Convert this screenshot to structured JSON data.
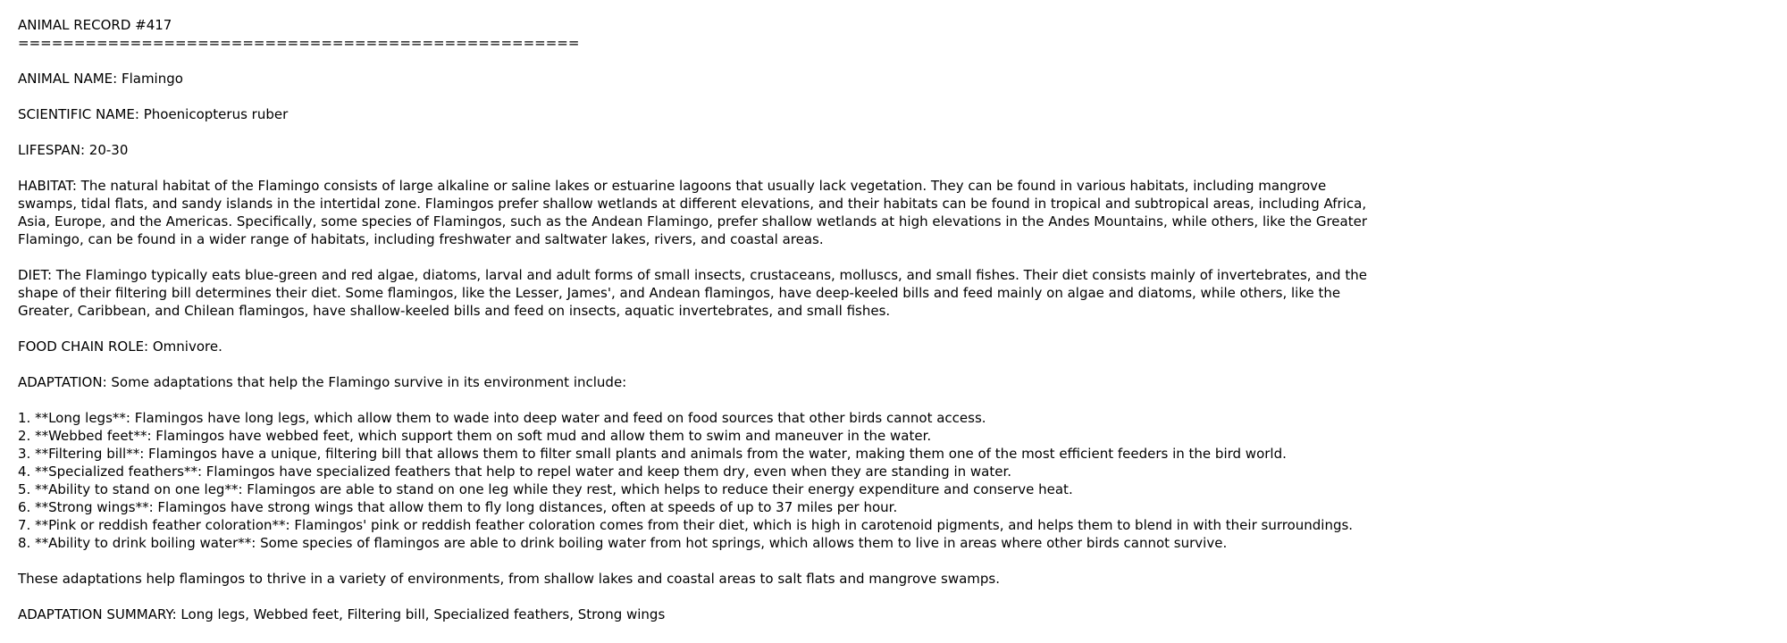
{
  "record": {
    "title": "ANIMAL RECORD #417",
    "divider": "=================================================="
  },
  "fields": {
    "animal_name": "ANIMAL NAME: Flamingo",
    "scientific_name": "SCIENTIFIC NAME: Phoenicopterus ruber",
    "lifespan": "LIFESPAN: 20-30",
    "habitat": "HABITAT: The natural habitat of the Flamingo consists of large alkaline or saline lakes or estuarine lagoons that usually lack vegetation. They can be found in various habitats, including mangrove swamps, tidal flats, and sandy islands in the intertidal zone. Flamingos prefer shallow wetlands at different elevations, and their habitats can be found in tropical and subtropical areas, including Africa, Asia, Europe, and the Americas. Specifically, some species of Flamingos, such as the Andean Flamingo, prefer shallow wetlands at high elevations in the Andes Mountains, while others, like the Greater Flamingo, can be found in a wider range of habitats, including freshwater and saltwater lakes, rivers, and coastal areas.",
    "diet": "DIET: The Flamingo typically eats blue-green and red algae, diatoms, larval and adult forms of small insects, crustaceans, molluscs, and small fishes. Their diet consists mainly of invertebrates, and the shape of their filtering bill determines their diet. Some flamingos, like the Lesser, James', and Andean flamingos, have deep-keeled bills and feed mainly on algae and diatoms, while others, like the Greater, Caribbean, and Chilean flamingos, have shallow-keeled bills and feed on insects, aquatic invertebrates, and small fishes.",
    "food_chain_role": "FOOD CHAIN ROLE: Omnivore.",
    "adaptation_intro": "ADAPTATION: Some adaptations that help the Flamingo survive in its environment include:",
    "adaptation_items": [
      "1. **Long legs**: Flamingos have long legs, which allow them to wade into deep water and feed on food sources that other birds cannot access.",
      "2. **Webbed feet**: Flamingos have webbed feet, which support them on soft mud and allow them to swim and maneuver in the water.",
      "3. **Filtering bill**: Flamingos have a unique, filtering bill that allows them to filter small plants and animals from the water, making them one of the most efficient feeders in the bird world.",
      "4. **Specialized feathers**: Flamingos have specialized feathers that help to repel water and keep them dry, even when they are standing in water.",
      "5. **Ability to stand on one leg**: Flamingos are able to stand on one leg while they rest, which helps to reduce their energy expenditure and conserve heat.",
      "6. **Strong wings**: Flamingos have strong wings that allow them to fly long distances, often at speeds of up to 37 miles per hour.",
      "7. **Pink or reddish feather coloration**: Flamingos' pink or reddish feather coloration comes from their diet, which is high in carotenoid pigments, and helps them to blend in with their surroundings.",
      "8. **Ability to drink boiling water**: Some species of flamingos are able to drink boiling water from hot springs, which allows them to live in areas where other birds cannot survive."
    ],
    "adaptation_conclusion": "These adaptations help flamingos to thrive in a variety of environments, from shallow lakes and coastal areas to salt flats and mangrove swamps.",
    "adaptation_summary": "ADAPTATION SUMMARY: Long legs, Webbed feet, Filtering bill, Specialized feathers, Strong wings"
  }
}
